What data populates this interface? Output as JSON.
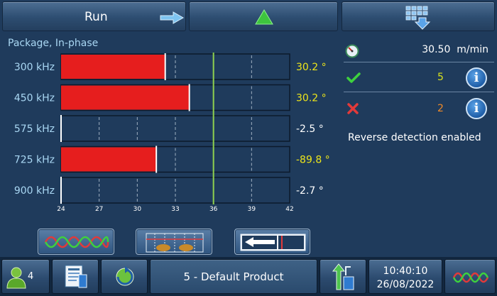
{
  "toolbar": {
    "run_label": "Run",
    "arrow_icon": "arrow-right-icon",
    "up_icon": "triangle-up-icon",
    "grid_icon": "grid-download-icon",
    "up_color": "#3ec43e"
  },
  "chart_data": {
    "type": "bar",
    "title": "Package, In-phase",
    "orientation": "horizontal",
    "categories": [
      "300 kHz",
      "450 kHz",
      "575 kHz",
      "725 kHz",
      "900 kHz"
    ],
    "values": [
      32.2,
      34.1,
      24.0,
      31.5,
      24.0
    ],
    "readouts": [
      "30.2 °",
      "30.2 °",
      "-2.5 °",
      "-89.8 °",
      "-2.7 °"
    ],
    "readout_colors": [
      "#ede51a",
      "#ede51a",
      "#ffffff",
      "#ede51a",
      "#ffffff"
    ],
    "xlim": [
      24,
      42
    ],
    "xticks": [
      "24",
      "27",
      "30",
      "33",
      "36",
      "39",
      "42"
    ],
    "threshold": 36,
    "bar_color": "#e61e1e",
    "threshold_color": "#8fd14f"
  },
  "status": {
    "speed": "30.50  m/min",
    "ok_count": "5",
    "reject_count": "2",
    "reverse_text": "Reverse detection enabled",
    "ok_color": "#d9e21a",
    "reject_color": "#f08a28"
  },
  "modes": {
    "wave_icon": "sine-wave-icon",
    "grid_icon": "package-grid-icon",
    "arrow_icon": "reverse-arrow-icon"
  },
  "bottom": {
    "user_count": "4",
    "product": "5 - Default Product",
    "time": "10:40:10",
    "date": "26/08/2022"
  }
}
